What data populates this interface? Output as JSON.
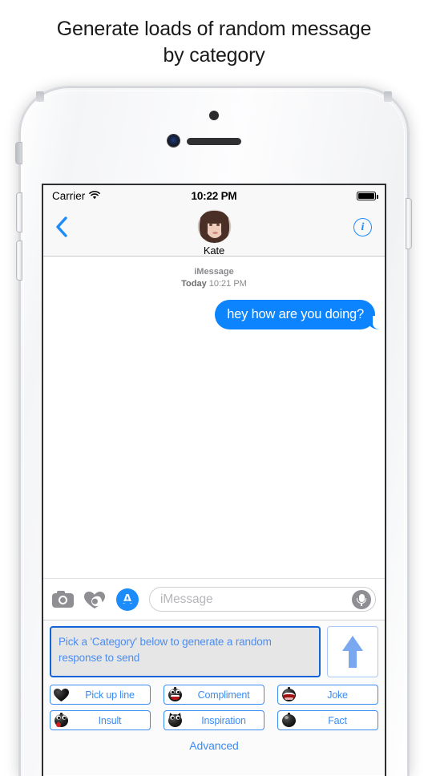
{
  "headline": {
    "line1": "Generate loads of random message",
    "line2": "by category"
  },
  "phone": {
    "status_bar": {
      "carrier": "Carrier",
      "wifi_icon": "wifi-icon",
      "time": "10:22 PM",
      "battery_icon": "battery-full-icon"
    },
    "nav_bar": {
      "back_icon": "back-chevron-icon",
      "contact_name": "Kate",
      "avatar": "contact-avatar",
      "info_icon": "info-circle-icon"
    },
    "conversation": {
      "service": "iMessage",
      "day": "Today",
      "time": "10:21 PM",
      "messages": [
        {
          "text": "hey how are you doing?",
          "side": "outgoing",
          "color": "#0b84fe"
        }
      ]
    },
    "input_bar": {
      "camera_icon": "camera-icon",
      "digital_touch_icon": "digital-touch-heart-icon",
      "appstore_icon": "app-store-icon",
      "placeholder": "iMessage",
      "mic_icon": "microphone-icon"
    },
    "app_extension": {
      "prompt_text": "Pick a 'Category' below to generate a random response to send",
      "send_icon": "send-arrow-up-icon",
      "categories": [
        {
          "label": "Pick up line",
          "icon": "black-heart-icon"
        },
        {
          "label": "Compliment",
          "icon": "laughing-face-icon"
        },
        {
          "label": "Joke",
          "icon": "open-mouth-face-icon"
        },
        {
          "label": "Insult",
          "icon": "tongue-out-face-icon"
        },
        {
          "label": "Inspiration",
          "icon": "devil-face-icon"
        },
        {
          "label": "Fact",
          "icon": "plain-black-face-icon"
        }
      ],
      "advanced_label": "Advanced"
    }
  },
  "colors": {
    "ios_blue": "#0b84fe",
    "link_blue": "#3b8cf0",
    "prompt_border": "#1064d8",
    "prompt_bg": "#e6e6e6",
    "send_arrow": "#7aa8f0"
  }
}
